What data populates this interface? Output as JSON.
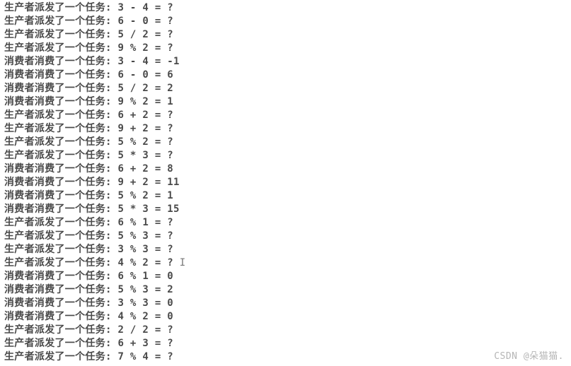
{
  "labels": {
    "producer": "生产者派发了一个任务: ",
    "consumer": "消费者消费了一个任务: "
  },
  "lines": [
    {
      "role": "producer",
      "expr": "3 - 4 = ?"
    },
    {
      "role": "producer",
      "expr": "6 - 0 = ?"
    },
    {
      "role": "producer",
      "expr": "5 / 2 = ?"
    },
    {
      "role": "producer",
      "expr": "9 % 2 = ?"
    },
    {
      "role": "consumer",
      "expr": "3 - 4 = -1"
    },
    {
      "role": "consumer",
      "expr": "6 - 0 = 6"
    },
    {
      "role": "consumer",
      "expr": "5 / 2 = 2"
    },
    {
      "role": "consumer",
      "expr": "9 % 2 = 1"
    },
    {
      "role": "producer",
      "expr": "6 + 2 = ?"
    },
    {
      "role": "producer",
      "expr": "9 + 2 = ?"
    },
    {
      "role": "producer",
      "expr": "5 % 2 = ?"
    },
    {
      "role": "producer",
      "expr": "5 * 3 = ?"
    },
    {
      "role": "consumer",
      "expr": "6 + 2 = 8"
    },
    {
      "role": "consumer",
      "expr": "9 + 2 = 11"
    },
    {
      "role": "consumer",
      "expr": "5 % 2 = 1"
    },
    {
      "role": "consumer",
      "expr": "5 * 3 = 15"
    },
    {
      "role": "producer",
      "expr": "6 % 1 = ?"
    },
    {
      "role": "producer",
      "expr": "5 % 3 = ?"
    },
    {
      "role": "producer",
      "expr": "3 % 3 = ?"
    },
    {
      "role": "producer",
      "expr": "4 % 2 = ?",
      "cursor": true
    },
    {
      "role": "consumer",
      "expr": "6 % 1 = 0"
    },
    {
      "role": "consumer",
      "expr": "5 % 3 = 2"
    },
    {
      "role": "consumer",
      "expr": "3 % 3 = 0"
    },
    {
      "role": "consumer",
      "expr": "4 % 2 = 0"
    },
    {
      "role": "producer",
      "expr": "2 / 2 = ?"
    },
    {
      "role": "producer",
      "expr": "6 + 3 = ?"
    },
    {
      "role": "producer",
      "expr": "7 % 4 = ?"
    }
  ],
  "watermark": "CSDN @朵猫猫."
}
